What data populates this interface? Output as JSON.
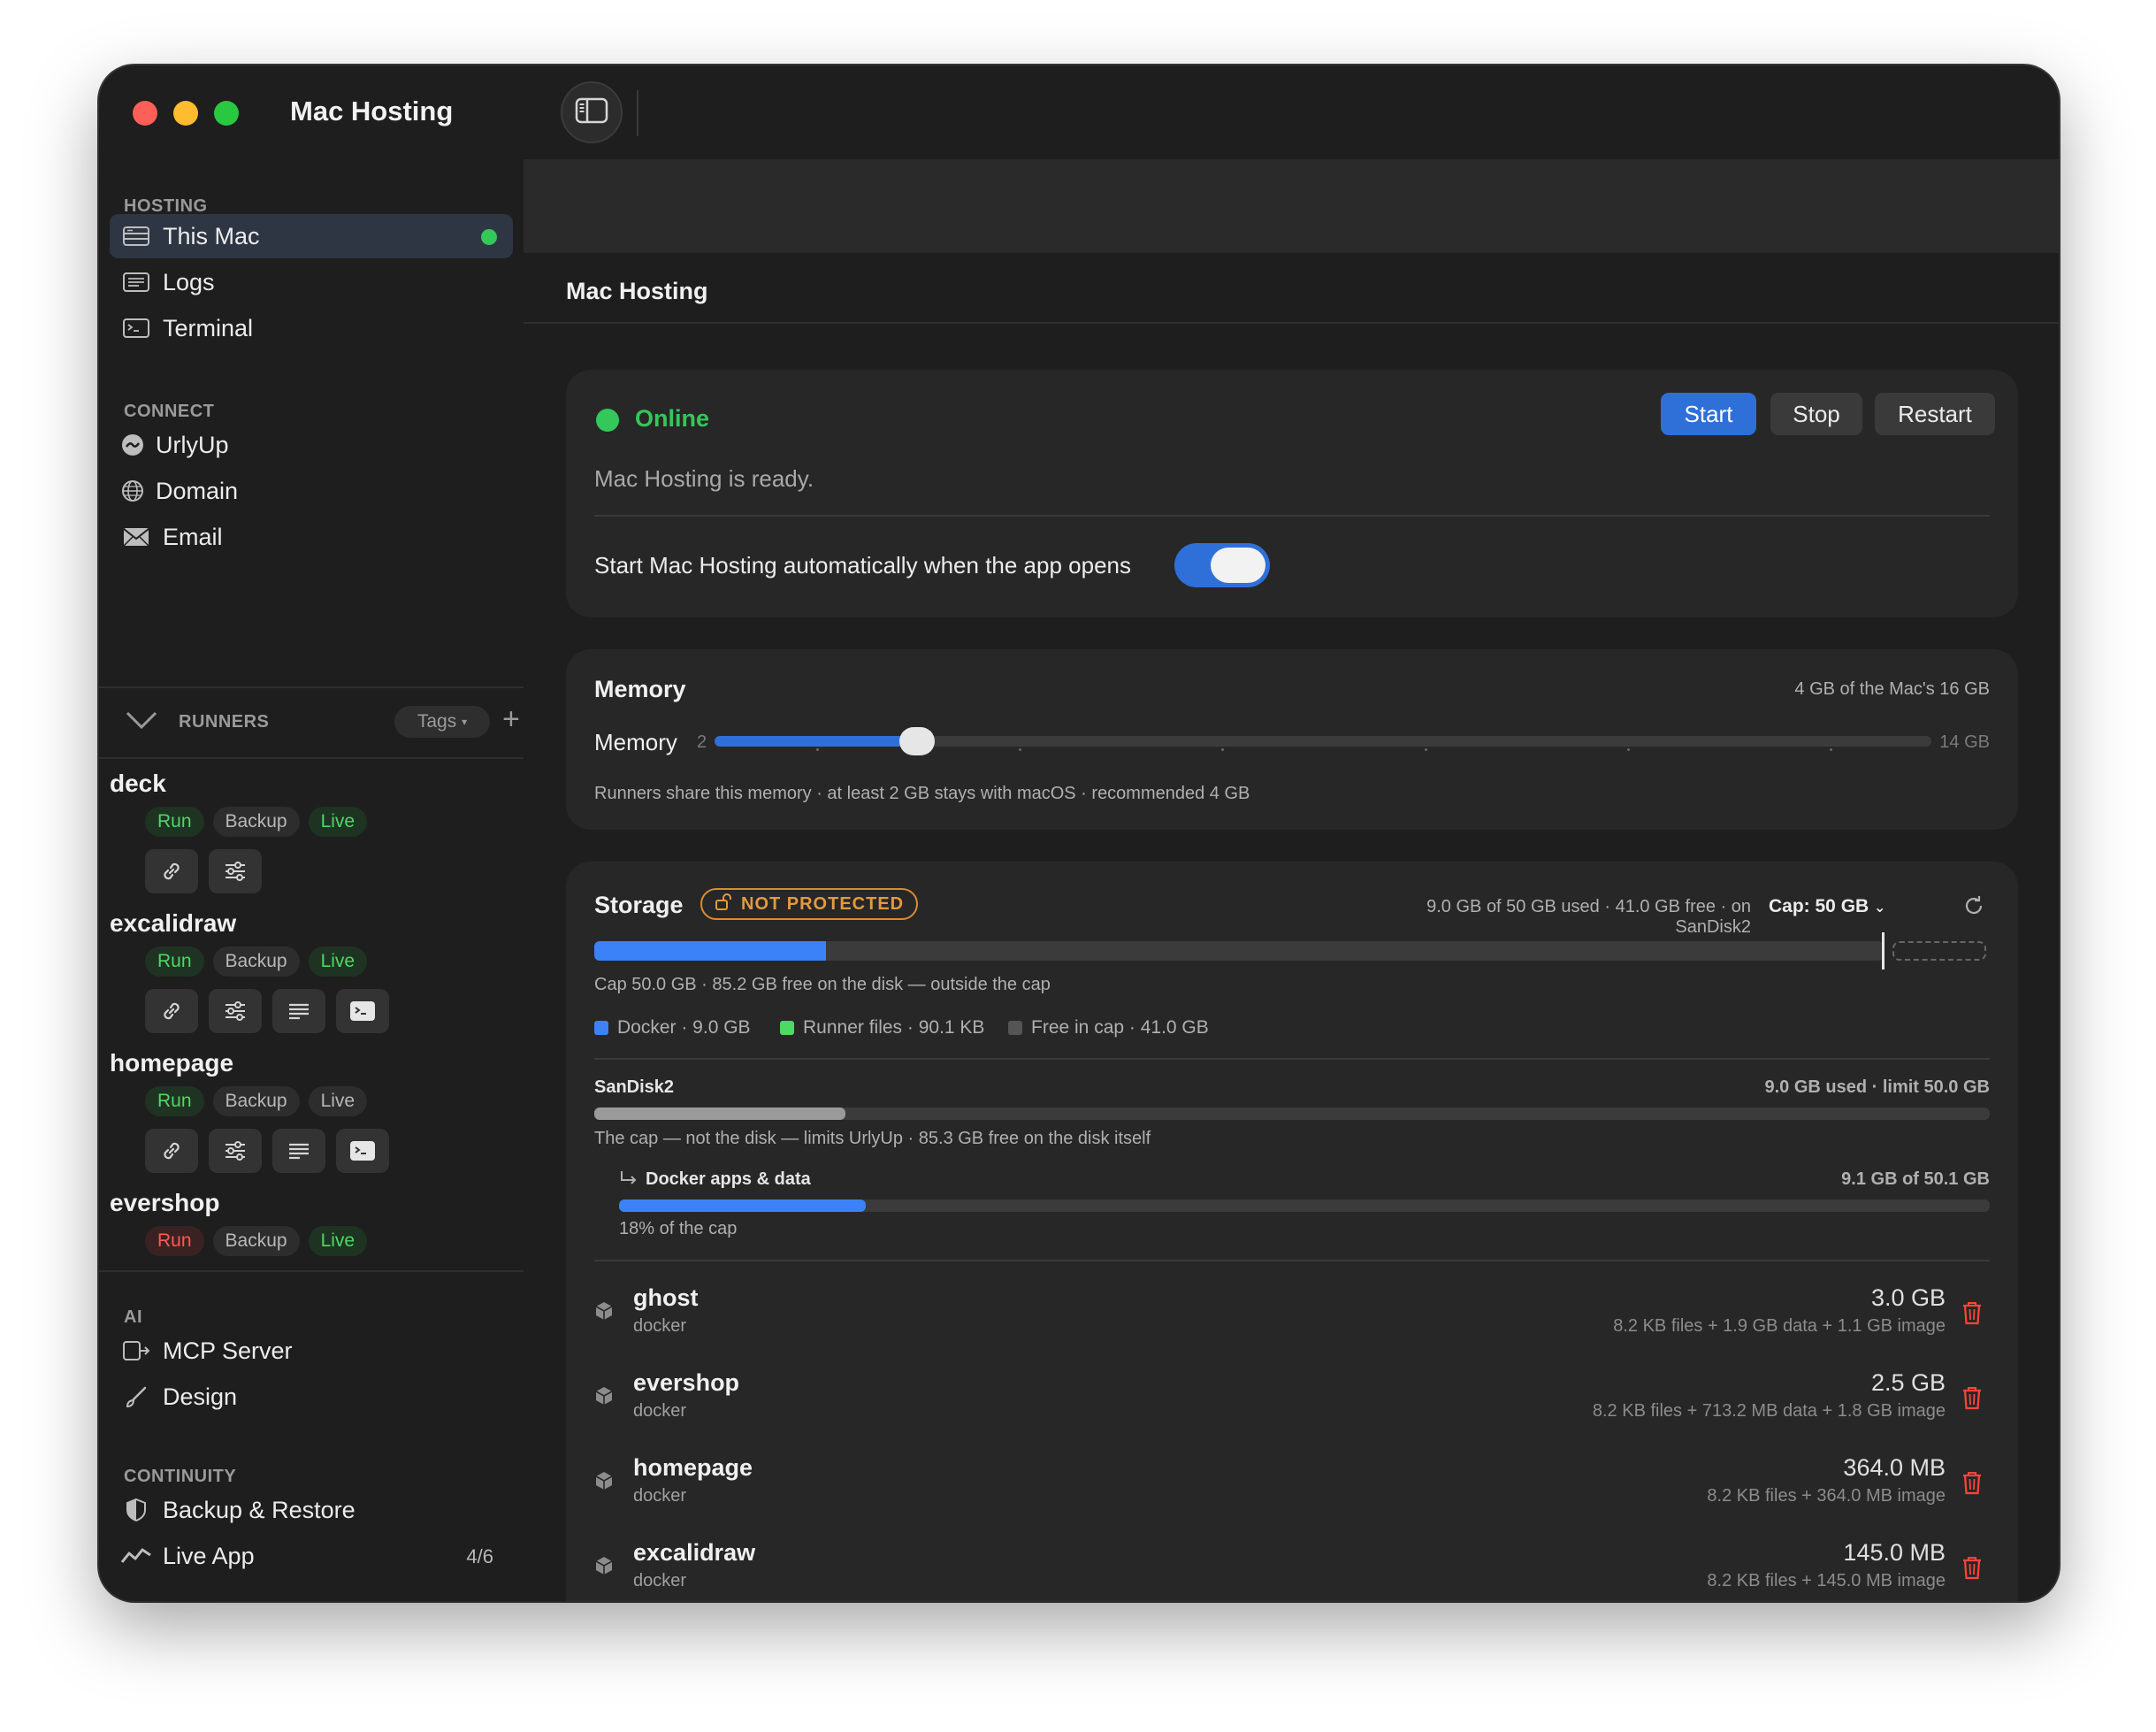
{
  "window": {
    "title": "Mac Hosting"
  },
  "sidebar": {
    "sections": {
      "hosting": "HOSTING",
      "connect": "CONNECT",
      "runners": "RUNNERS",
      "ai": "AI",
      "continuity": "CONTINUITY"
    },
    "hosting_items": [
      {
        "label": "This Mac",
        "icon": "server-icon",
        "active": true,
        "status": "online"
      },
      {
        "label": "Logs",
        "icon": "list-icon"
      },
      {
        "label": "Terminal",
        "icon": "terminal-icon"
      }
    ],
    "connect_items": [
      {
        "label": "UrlyUp",
        "icon": "urlyup-icon"
      },
      {
        "label": "Domain",
        "icon": "globe-icon"
      },
      {
        "label": "Email",
        "icon": "envelope-icon"
      }
    ],
    "runners_tags": "Tags",
    "runners": [
      {
        "name": "deck",
        "badges": {
          "run": "Run",
          "backup": "Backup",
          "live": "Live"
        }
      },
      {
        "name": "excalidraw",
        "badges": {
          "run": "Run",
          "backup": "Backup",
          "live": "Live"
        }
      },
      {
        "name": "homepage",
        "badges": {
          "run": "Run",
          "backup": "Backup",
          "live": "Live"
        }
      },
      {
        "name": "evershop",
        "badges": {
          "run": "Run",
          "backup": "Backup",
          "live": "Live"
        }
      }
    ],
    "ai_items": [
      {
        "label": "MCP Server",
        "icon": "mcp-icon"
      },
      {
        "label": "Design",
        "icon": "brush-icon"
      }
    ],
    "continuity_items": [
      {
        "label": "Backup & Restore",
        "icon": "shield-icon"
      },
      {
        "label": "Live App",
        "icon": "pulse-icon",
        "count": "4/6"
      }
    ]
  },
  "main": {
    "title": "Mac Hosting",
    "status": {
      "label": "Online",
      "message": "Mac Hosting is ready.",
      "buttons": {
        "start": "Start",
        "stop": "Stop",
        "restart": "Restart"
      },
      "autostart_label": "Start Mac Hosting automatically when the app opens",
      "autostart_on": true
    },
    "memory": {
      "title": "Memory",
      "summary": "4 GB of the Mac's 16 GB",
      "slider_label": "Memory",
      "min_label": "2",
      "max_label": "14 GB",
      "min": 2,
      "max": 14,
      "value": 4,
      "caption": "Runners share this memory · at least 2 GB stays with macOS · recommended 4 GB"
    },
    "storage": {
      "title": "Storage",
      "badge": "NOT PROTECTED",
      "summary": "9.0 GB of 50 GB used · 41.0 GB free · on SanDisk2",
      "cap_select": "Cap: 50 GB",
      "used_fraction": 0.18,
      "cap_caption": "Cap 50.0 GB · 85.2 GB free on the disk — outside the cap",
      "legend": [
        {
          "label": "Docker · 9.0 GB",
          "color": "#3b82f6"
        },
        {
          "label": "Runner files · 90.1 KB",
          "color": "#4cd964"
        },
        {
          "label": "Free in cap · 41.0 GB",
          "color": "#555555"
        }
      ],
      "disk": {
        "name": "SanDisk2",
        "summary": "9.0 GB used · limit 50.0 GB",
        "fraction": 0.18,
        "caption": "The cap — not the disk — limits UrlyUp · 85.3 GB free on the disk itself"
      },
      "docker": {
        "name": "Docker apps & data",
        "summary": "9.1 GB of 50.1 GB",
        "fraction": 0.18,
        "caption": "18% of the cap"
      },
      "rows": [
        {
          "name": "ghost",
          "type": "docker",
          "size": "3.0 GB",
          "detail": "8.2 KB files + 1.9 GB data + 1.1 GB image"
        },
        {
          "name": "evershop",
          "type": "docker",
          "size": "2.5 GB",
          "detail": "8.2 KB files + 713.2 MB data + 1.8 GB image"
        },
        {
          "name": "homepage",
          "type": "docker",
          "size": "364.0 MB",
          "detail": "8.2 KB files + 364.0 MB image"
        },
        {
          "name": "excalidraw",
          "type": "docker",
          "size": "145.0 MB",
          "detail": "8.2 KB files + 145.0 MB image"
        }
      ]
    }
  },
  "colors": {
    "accent": "#2f6fd8",
    "online": "#34c759",
    "warning": "#e39a3e",
    "danger": "#ff453a"
  }
}
